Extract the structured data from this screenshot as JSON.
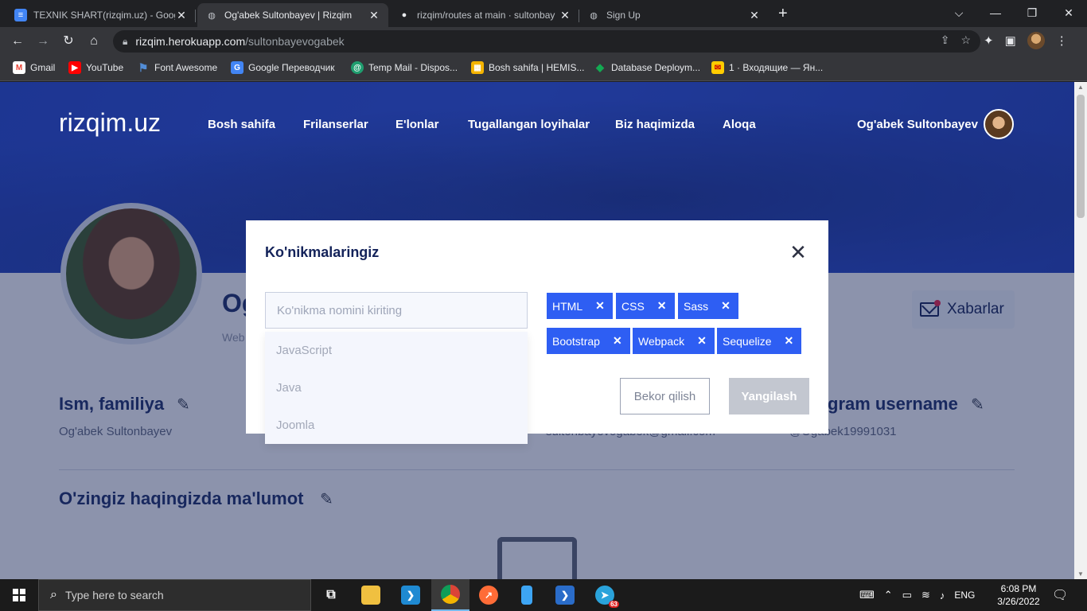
{
  "browser": {
    "tabs": [
      {
        "title": "TEXNIK SHART(rizqim.uz) - Goog",
        "icon": "docs-icon",
        "active": false
      },
      {
        "title": "Og'abek Sultonbayev | Rizqim",
        "icon": "globe-icon",
        "active": true
      },
      {
        "title": "rizqim/routes at main · sultonbay",
        "icon": "github-icon",
        "active": false
      },
      {
        "title": "Sign Up",
        "icon": "globe-icon",
        "active": false
      }
    ],
    "new_tab": "+",
    "window_controls": {
      "minimize": "⌵",
      "restore": "—",
      "maximize": "❐",
      "close": "✕"
    },
    "url_host": "rizqim.herokuapp.com",
    "url_path": "/sultonbayevogabek",
    "bookmarks": [
      {
        "label": "Gmail",
        "color": "#ea4335",
        "glyph": "M"
      },
      {
        "label": "YouTube",
        "color": "#ff0000",
        "glyph": "▶"
      },
      {
        "label": "Font Awesome",
        "color": "#528dd7",
        "glyph": "⚑"
      },
      {
        "label": "Google Переводчик",
        "color": "#4285f4",
        "glyph": "G"
      },
      {
        "label": "Temp Mail - Dispos...",
        "color": "#1f9e6f",
        "glyph": "@"
      },
      {
        "label": "Bosh sahifa | HEMIS...",
        "color": "#f4b400",
        "glyph": "▦"
      },
      {
        "label": "Database Deploym...",
        "color": "#13aa52",
        "glyph": "◆"
      },
      {
        "label": "1 · Входящие — Ян...",
        "color": "#ffcc00",
        "glyph": "✉"
      }
    ]
  },
  "site": {
    "logo": "rizqim.uz",
    "nav": [
      "Bosh sahifa",
      "Frilanserlar",
      "E'lonlar",
      "Tugallangan loyihalar",
      "Biz haqimizda",
      "Aloqa"
    ],
    "user_name": "Og'abek Sultonbayev",
    "profile_name_partial": "Og",
    "profile_role_partial": "Web",
    "messages_button": "Xabarlar",
    "fields": [
      {
        "title": "Ism, familiya",
        "value": "Og'abek Sultonbayev"
      },
      {
        "title": "gram username",
        "value": "@Ogabek19991031"
      }
    ],
    "email_partial": "sultonbayevogabek@gmail.com",
    "about_title": "O'zingiz haqingizda ma'lumot"
  },
  "modal": {
    "title": "Ko'nikmalaringiz",
    "input_placeholder": "Ko'nikma nomini kiriting",
    "suggestions": [
      "JavaScript",
      "Java",
      "Joomla"
    ],
    "skills": [
      "HTML",
      "CSS",
      "Sass",
      "Bootstrap",
      "Webpack",
      "Sequelize"
    ],
    "cancel_label": "Bekor qilish",
    "update_label": "Yangilash",
    "accent_color": "#2e5ef3"
  },
  "taskbar": {
    "search_placeholder": "Type here to search",
    "language": "ENG",
    "time": "6:08 PM",
    "date": "3/26/2022",
    "telegram_badge": "63"
  }
}
